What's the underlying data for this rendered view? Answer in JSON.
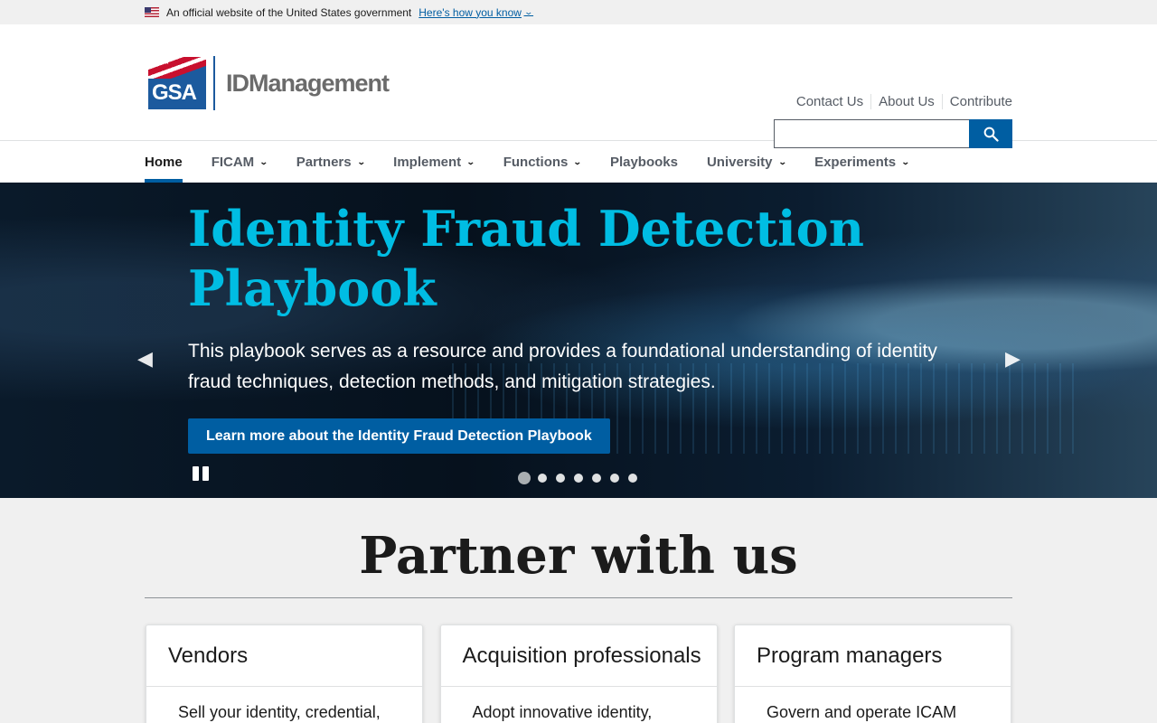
{
  "gov_banner": {
    "text": "An official website of the United States government",
    "link": "Here's how you know"
  },
  "header": {
    "logo_mark": "GSA",
    "logo_name": "IDManagement",
    "util_nav": [
      "Contact Us",
      "About Us",
      "Contribute"
    ],
    "search_value": ""
  },
  "nav": [
    {
      "label": "Home",
      "active": true,
      "dropdown": false
    },
    {
      "label": "FICAM",
      "dropdown": true
    },
    {
      "label": "Partners",
      "dropdown": true
    },
    {
      "label": "Implement",
      "dropdown": true
    },
    {
      "label": "Functions",
      "dropdown": true
    },
    {
      "label": "Playbooks",
      "dropdown": false
    },
    {
      "label": "University",
      "dropdown": true
    },
    {
      "label": "Experiments",
      "dropdown": true
    }
  ],
  "hero": {
    "title": "Identity Fraud Detection Playbook",
    "text": "This playbook serves as a resource and provides a foundational understanding of identity fraud techniques, detection methods, and mitigation strategies.",
    "button": "Learn more about the Identity Fraud Detection Playbook",
    "slide_count": 7,
    "active_slide": 1
  },
  "partner": {
    "title": "Partner with us",
    "cards": [
      {
        "title": "Vendors",
        "body": "Sell your identity, credential,"
      },
      {
        "title": "Acquisition professionals",
        "body": "Adopt innovative identity,"
      },
      {
        "title": "Program managers",
        "body": "Govern and operate ICAM"
      }
    ]
  },
  "colors": {
    "primary": "#005ea2",
    "hero_title": "#00bde3",
    "text": "#1b1b1b"
  }
}
